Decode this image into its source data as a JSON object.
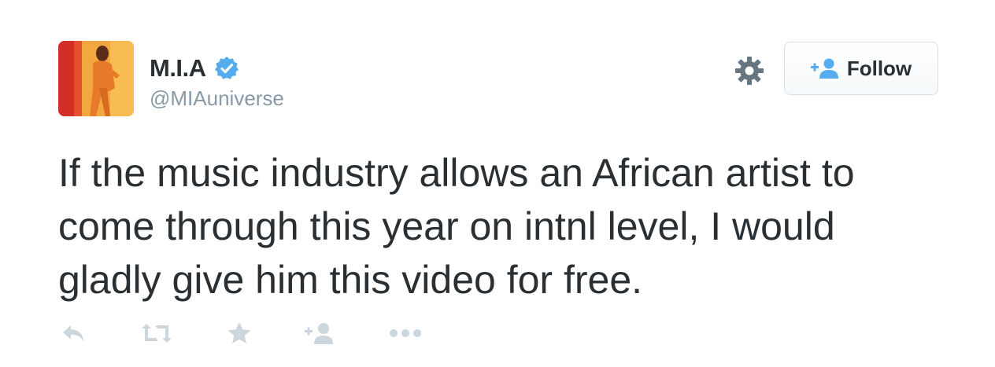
{
  "tweet": {
    "author": {
      "name": "M.I.A",
      "handle": "@MIAuniverse",
      "verified": true
    },
    "follow_button": {
      "label": "Follow",
      "icon": "add-user-icon"
    },
    "settings_icon": "gear-icon",
    "text": "If the music industry allows an African artist to\ncome through this year on intnl level, I would\ngladly give him this video for free.",
    "actions": [
      {
        "name": "reply",
        "icon": "reply-icon"
      },
      {
        "name": "retweet",
        "icon": "retweet-icon"
      },
      {
        "name": "favorite",
        "icon": "star-icon"
      },
      {
        "name": "follow",
        "icon": "add-user-icon"
      },
      {
        "name": "more",
        "icon": "more-dots-icon"
      }
    ]
  },
  "colors": {
    "text": "#292f33",
    "secondary": "#8899a6",
    "action_icon": "#ccd6dd",
    "verified": "#55acee",
    "follow_icon": "#55acee",
    "gear": "#66757f"
  }
}
